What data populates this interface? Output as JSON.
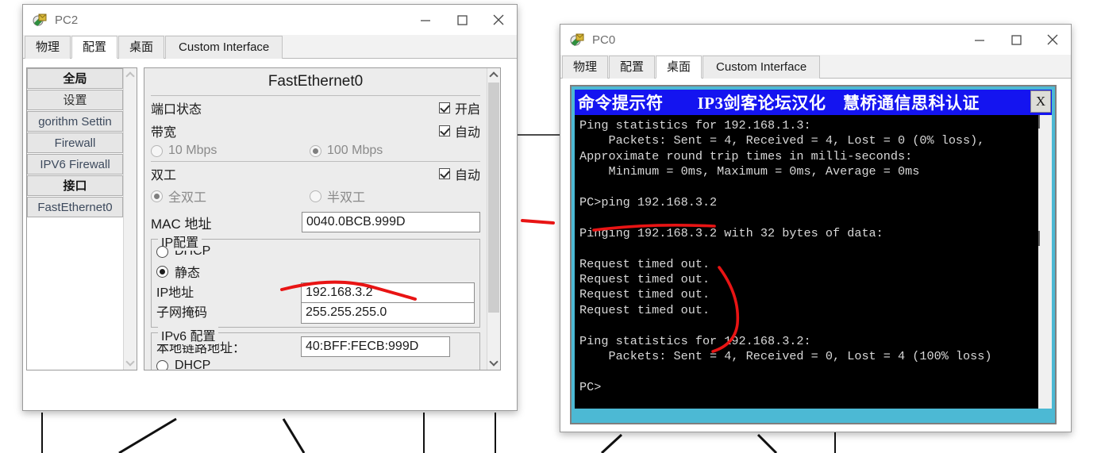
{
  "windows": {
    "pc2": {
      "title": "PC2",
      "icon": "packet-tracer-pc-icon",
      "controls": {
        "minimize": "–",
        "maximize": "□",
        "close": "✕"
      },
      "tabs": [
        {
          "label": "物理",
          "active": false
        },
        {
          "label": "配置",
          "active": true
        },
        {
          "label": "桌面",
          "active": false
        },
        {
          "label": "Custom Interface",
          "active": false
        }
      ],
      "sidebar": [
        {
          "label": "全局",
          "type": "header"
        },
        {
          "label": "设置",
          "type": "item"
        },
        {
          "label": "gorithm Settin",
          "type": "item-clipped"
        },
        {
          "label": "Firewall",
          "type": "item"
        },
        {
          "label": "IPV6 Firewall",
          "type": "item"
        },
        {
          "label": "接口",
          "type": "header"
        },
        {
          "label": "FastEthernet0",
          "type": "item"
        }
      ],
      "panel": {
        "title": "FastEthernet0",
        "port_status": {
          "label": "端口状态",
          "checkbox_label": "开启",
          "checked": true
        },
        "bandwidth": {
          "label": "带宽",
          "checkbox_label": "自动",
          "checked": true,
          "options": [
            {
              "label": "10 Mbps",
              "selected": false
            },
            {
              "label": "100 Mbps",
              "selected": true
            }
          ]
        },
        "duplex": {
          "label": "双工",
          "checkbox_label": "自动",
          "checked": true,
          "options": [
            {
              "label": "全双工",
              "selected": true
            },
            {
              "label": "半双工",
              "selected": false
            }
          ]
        },
        "mac": {
          "label": "MAC 地址",
          "value": "0040.0BCB.999D"
        },
        "ip_config": {
          "title": "IP配置",
          "dhcp_label": "DHCP",
          "dhcp_selected": false,
          "static_label": "静态",
          "static_selected": true,
          "ip_label": "IP地址",
          "ip_value": "192.168.3.2",
          "mask_label": "子网掩码",
          "mask_value": "255.255.255.0"
        },
        "ipv6_config": {
          "title": "IPv6 配置",
          "link_local_label": "本地链路地址：",
          "link_local_value": "40:BFF:FECB:999D",
          "dhcp_label": "DHCP",
          "dhcp_selected": false
        }
      }
    },
    "pc0": {
      "title": "PC0",
      "icon": "packet-tracer-pc-icon",
      "controls": {
        "minimize": "–",
        "maximize": "□",
        "close": "✕"
      },
      "tabs": [
        {
          "label": "物理",
          "active": false
        },
        {
          "label": "配置",
          "active": false
        },
        {
          "label": "桌面",
          "active": true
        },
        {
          "label": "Custom Interface",
          "active": false
        }
      ],
      "terminal": {
        "titlebar": "命令提示符　　IP3剑客论坛汉化　慧桥通信思科认证",
        "close_label": "X",
        "lines": [
          "Ping statistics for 192.168.1.3:",
          "    Packets: Sent = 4, Received = 4, Lost = 0 (0% loss),",
          "Approximate round trip times in milli-seconds:",
          "    Minimum = 0ms, Maximum = 0ms, Average = 0ms",
          "",
          "PC>ping 192.168.3.2",
          "",
          "Pinging 192.168.3.2 with 32 bytes of data:",
          "",
          "Request timed out.",
          "Request timed out.",
          "Request timed out.",
          "Request timed out.",
          "",
          "Ping statistics for 192.168.3.2:",
          "    Packets: Sent = 4, Received = 0, Lost = 4 (100% loss)",
          "",
          "PC>"
        ]
      }
    }
  },
  "colors": {
    "terminal_titlebar_blue": "#1414f0",
    "terminal_frame_cyan": "#4cb9d4",
    "terminal_background": "#000000",
    "terminal_text": "#d8d8d8",
    "annotation_red": "#e81414",
    "window_border": "#9a9a9a"
  },
  "annotations": [
    {
      "name": "ip-address-underline",
      "color": "#e81414"
    },
    {
      "name": "ping-command-underline",
      "color": "#e81414"
    },
    {
      "name": "timeout-bracket",
      "color": "#e81414"
    },
    {
      "name": "gap-marker-line",
      "color": "#e81414"
    }
  ]
}
